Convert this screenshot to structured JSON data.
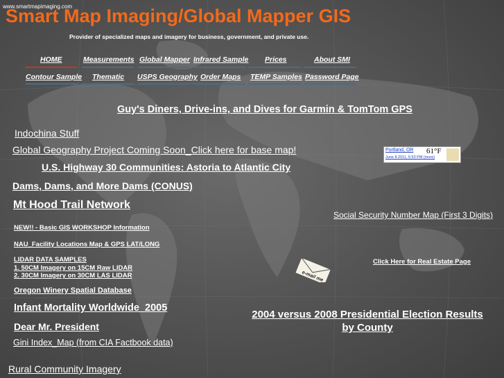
{
  "header": {
    "url_text": "www.smartmapimaging.com",
    "title": "Smart Map Imaging/Global Mapper GIS",
    "tagline": "Provider of specialized maps and imagery for business, government, and private use."
  },
  "nav": {
    "row1": [
      "HOME",
      "Measurements",
      "Global Mapper",
      "Infrared Sample",
      "Prices",
      "About SMI"
    ],
    "row2": [
      "Contour Sample",
      "Thematic",
      "USPS Geography",
      "Order Maps",
      "TEMP Samples",
      "Password Page"
    ]
  },
  "links": {
    "guys_diners": "Guy's Diners, Drive-ins, and Dives for Garmin & TomTom GPS",
    "indochina": "Indochina Stuff",
    "global_geo": "Global Geography Project Coming Soon_Click here for base map!",
    "us_highway": "U.S. Highway 30 Communities: Astoria to Atlantic City",
    "dams": "Dams, Dams, and More Dams (CONUS)",
    "mt_hood": "Mt Hood Trail Network",
    "ssn_map": "Social Security Number Map (First 3 Digits)",
    "gis_workshop": "NEW!! - Basic GIS WORKSHOP Information",
    "nau": "NAU_Facility Locations Map & GPS LAT/LONG",
    "lidar_header": "LIDAR DATA SAMPLES",
    "lidar_1": "1. 50CM Imagery on 15CM Raw LIDAR",
    "lidar_2": "2. 30CM Imagery on 30CM LAS LIDAR",
    "real_estate": "Click Here for Real Estate Page",
    "oregon_winery": "Oregon Winery Spatial Database",
    "infant_mortality": "Infant Mortality Worldwide_2005",
    "election_line1": "2004 versus 2008 Presidential Election Results",
    "election_line2": "by County",
    "dear_president": "Dear Mr. President",
    "gini": "Gini Index_Map (from CIA Factbook data)",
    "rural": "Rural Community Imagery"
  },
  "weather": {
    "city": "Portland, OR",
    "temp": "61°F",
    "datetime": "June 8 2011, 5:53 PM (more)"
  },
  "email_label": "e-mail me",
  "colors": {
    "title": "#f26a1b",
    "nav_bar": "#4a6b8a",
    "nav_active": "#c0392b"
  }
}
